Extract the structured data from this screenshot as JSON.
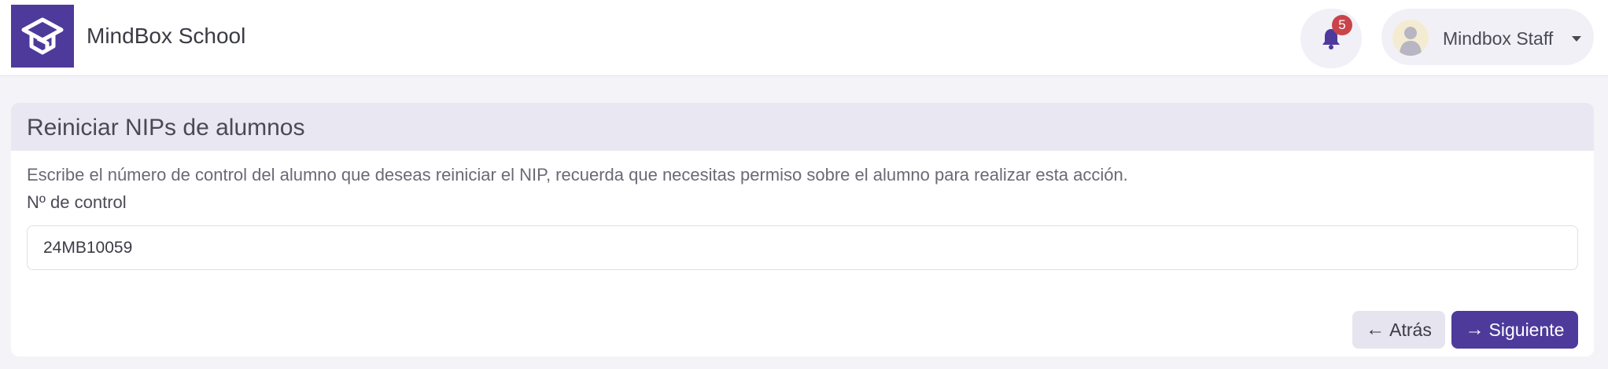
{
  "app": {
    "name": "MindBox School"
  },
  "header": {
    "notifications": {
      "count": "5",
      "icon": "bell-icon"
    },
    "user": {
      "name": "Mindbox Staff",
      "icon": "avatar-icon"
    }
  },
  "page": {
    "title": "Reiniciar NIPs de alumnos",
    "description": "Escribe el número de control del alumno que deseas reiniciar el NIP, recuerda que necesitas permiso sobre el alumno para realizar esta acción.",
    "field_label": "Nº de control",
    "control_number": "24MB10059",
    "buttons": {
      "back": "Atrás",
      "next": "Siguiente",
      "back_icon": "←",
      "next_icon": "→"
    }
  },
  "colors": {
    "primary": "#4e3a9b",
    "badge": "#c9444a",
    "header_bg": "#e9e7f1"
  }
}
